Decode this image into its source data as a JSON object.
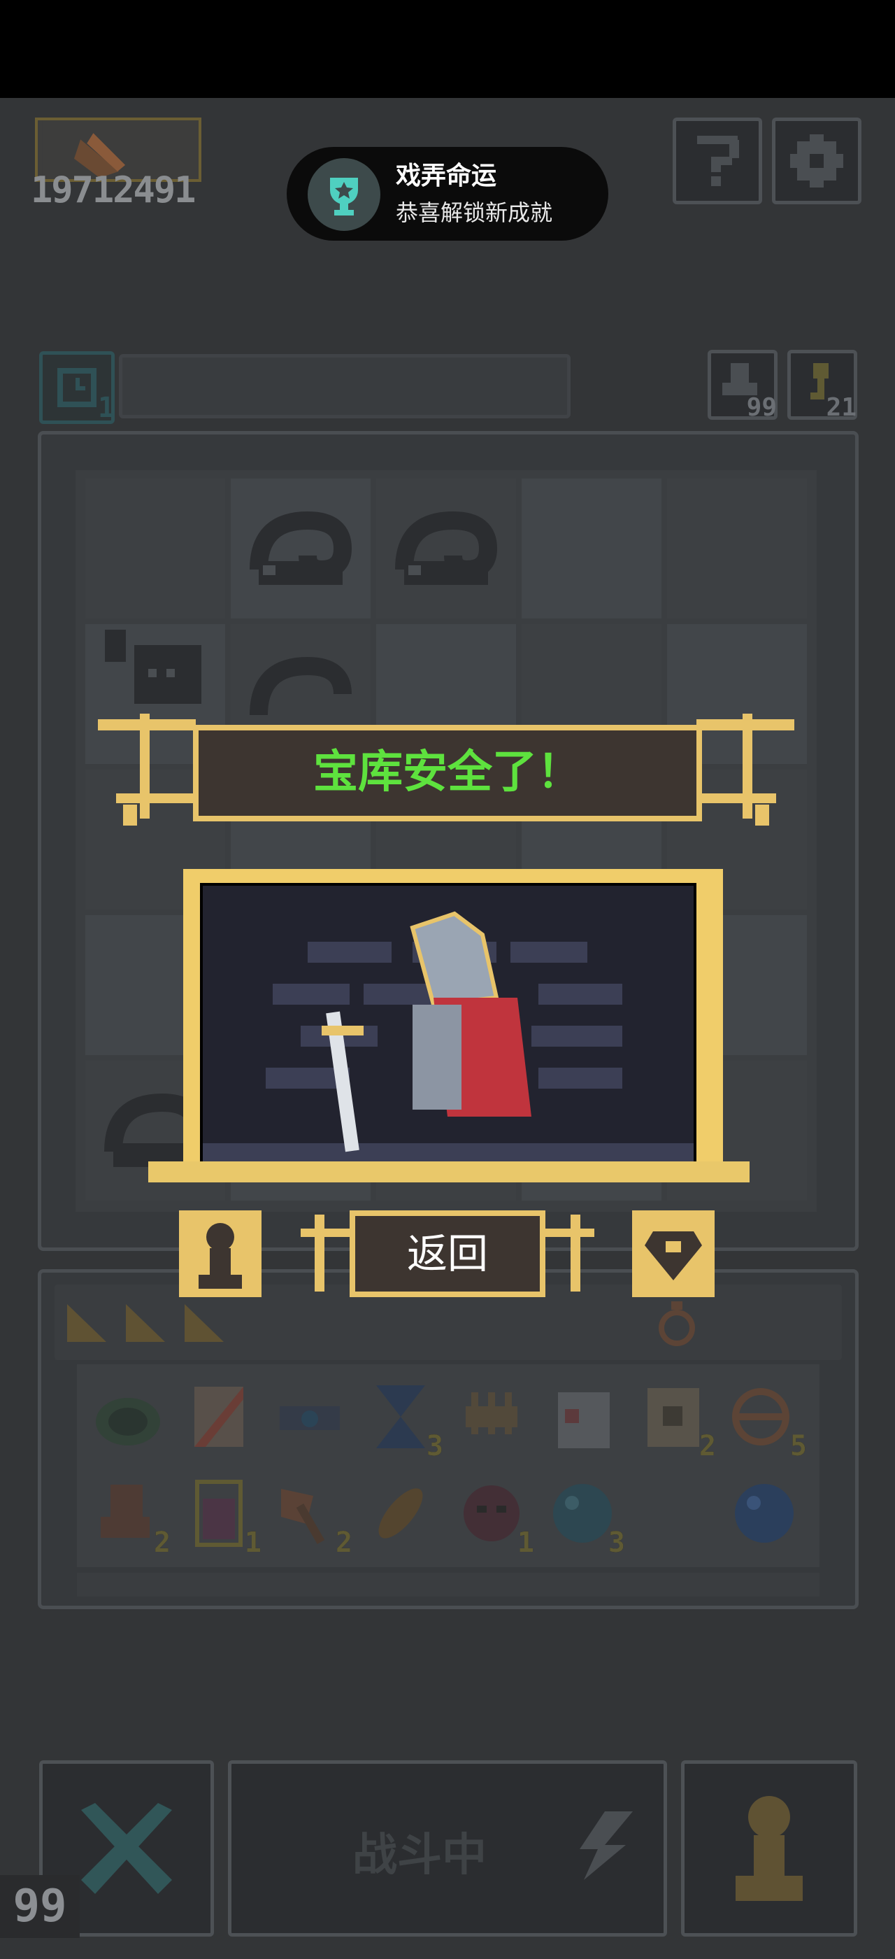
{
  "header": {
    "score": "19712491",
    "help_icon": "question-mark-icon",
    "settings_icon": "gear-icon"
  },
  "toast": {
    "icon": "trophy-icon",
    "title": "戏弄命运",
    "subtitle": "恭喜解锁新成就"
  },
  "timer": {
    "icon": "clock-icon",
    "count": "1"
  },
  "resources": [
    {
      "icon": "boot-icon",
      "count": "99"
    },
    {
      "icon": "key-icon",
      "count": "21"
    }
  ],
  "inventory": {
    "row1": [
      {
        "icon": "turtle-shell-icon",
        "count": ""
      },
      {
        "icon": "scroll-icon",
        "count": ""
      },
      {
        "icon": "goggles-icon",
        "count": ""
      },
      {
        "icon": "hourglass-icon",
        "count": "3"
      },
      {
        "icon": "claw-icon",
        "count": ""
      },
      {
        "icon": "gauntlet-icon",
        "count": ""
      },
      {
        "icon": "map-icon",
        "count": "2"
      },
      {
        "icon": "ring-icon",
        "count": "5"
      }
    ],
    "row2": [
      {
        "icon": "boot-bag-icon",
        "count": "2"
      },
      {
        "icon": "potion-jar-icon",
        "count": "1"
      },
      {
        "icon": "axe-icon",
        "count": "2"
      },
      {
        "icon": "feather-icon",
        "count": ""
      },
      {
        "icon": "demon-mask-icon",
        "count": "1"
      },
      {
        "icon": "orb-icon",
        "count": "3"
      },
      {
        "icon": "empty-slot",
        "count": ""
      },
      {
        "icon": "blue-orb-icon",
        "count": ""
      }
    ]
  },
  "modal": {
    "title": "宝库安全了！",
    "back_label": "返回",
    "left_icon": "pawn-icon",
    "right_icon": "heart-shield-icon"
  },
  "bottom": {
    "battle_label": "战斗中",
    "corner_count": "99"
  },
  "colors": {
    "gold": "#e8c46a",
    "title_green": "#5ee23e",
    "panel_brown": "#3d3530",
    "background": "#333537"
  }
}
